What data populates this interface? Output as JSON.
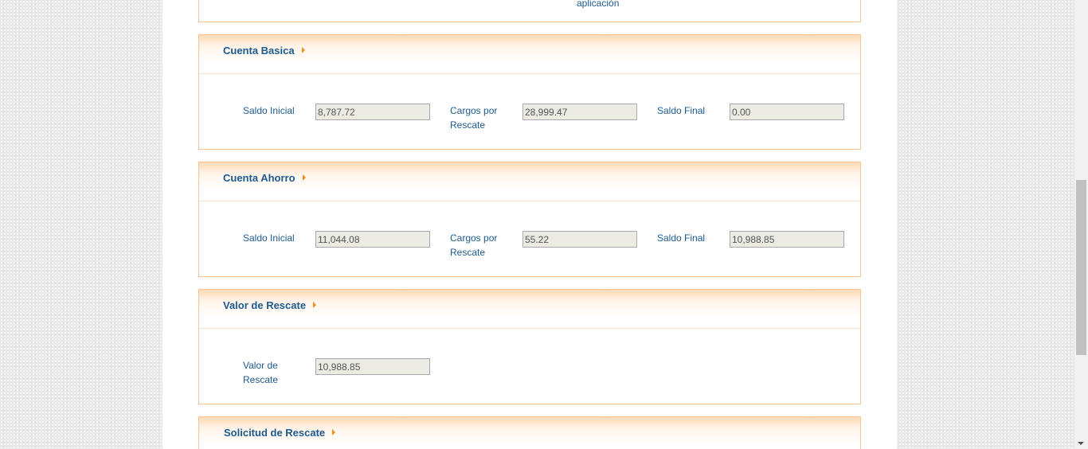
{
  "top_panel": {
    "partial_text": "aplicación"
  },
  "cuenta_basica": {
    "title": "Cuenta Basica",
    "saldo_inicial_label": "Saldo Inicial",
    "saldo_inicial_value": "8,787.72",
    "cargos_label": "Cargos por Rescate",
    "cargos_value": "28,999.47",
    "saldo_final_label": "Saldo Final",
    "saldo_final_value": "0.00"
  },
  "cuenta_ahorro": {
    "title": "Cuenta Ahorro",
    "saldo_inicial_label": "Saldo Inicial",
    "saldo_inicial_value": "11,044.08",
    "cargos_label": "Cargos por Rescate",
    "cargos_value": "55.22",
    "saldo_final_label": "Saldo Final",
    "saldo_final_value": "10,988.85"
  },
  "valor_rescate": {
    "title": "Valor de Rescate",
    "label": "Valor de Rescate",
    "value": "10,988.85"
  },
  "solicitud_rescate": {
    "title": "Solicitud de Rescate"
  },
  "colors": {
    "label_blue": "#1d5a8e",
    "panel_border": "#f7c58f",
    "arrow_orange": "#f08a1d",
    "disabled_field_bg": "#ebebe4"
  }
}
